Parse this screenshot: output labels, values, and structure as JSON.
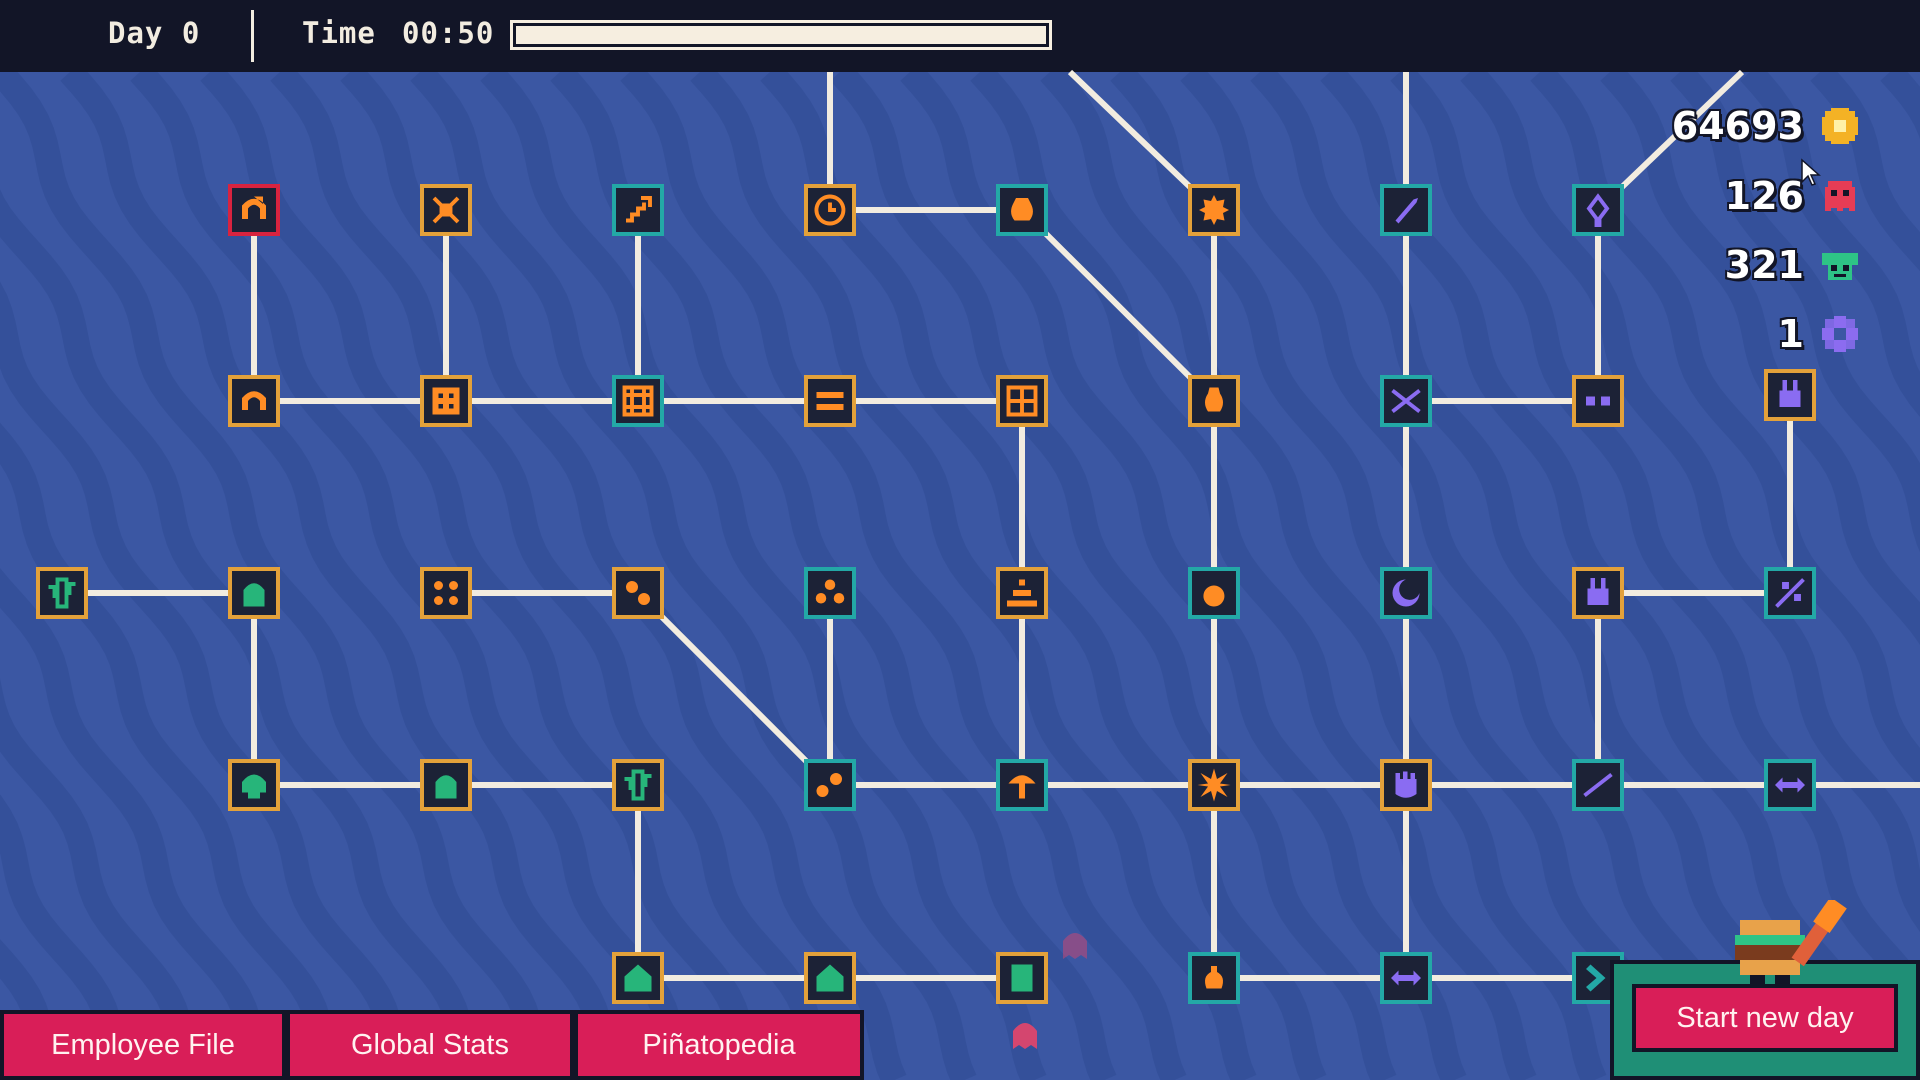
{
  "hud": {
    "day_label": "Day 0",
    "time_label": "Time",
    "time_value": "00:50",
    "time_progress": 1.0
  },
  "resources": [
    {
      "value": "64693",
      "icon": "coin-icon",
      "color": "#f4b225"
    },
    {
      "value": "126",
      "icon": "red-ghost-icon",
      "color": "#e63c55"
    },
    {
      "value": "321",
      "icon": "green-creature-icon",
      "color": "#2ec486"
    },
    {
      "value": "1",
      "icon": "purple-gear-icon",
      "color": "#8c6cf0"
    }
  ],
  "buttons": {
    "employee_file": "Employee File",
    "global_stats": "Global Stats",
    "pinatopedia": "Piñatopedia",
    "start_new_day": "Start new day"
  },
  "colors": {
    "background": "#3b57a3",
    "top_bar": "#121527",
    "button": "#d91e58",
    "node_border_gold": "#e3a13a",
    "node_border_teal": "#23a8a6",
    "node_border_red": "#d8233f",
    "orange_icon": "#ff8c24",
    "green_icon": "#27b57a",
    "purple_icon": "#8a6cf2",
    "link": "#f2ece0"
  },
  "skill_tree": {
    "nodes": [
      {
        "id": "n1",
        "icon": "arch-arrow-icon",
        "color": "orange",
        "border": "red"
      },
      {
        "id": "n2",
        "icon": "crossed-swords-icon",
        "color": "orange",
        "border": "gold"
      },
      {
        "id": "n3",
        "icon": "stairs-arrow-icon",
        "color": "orange",
        "border": "teal"
      },
      {
        "id": "n4",
        "icon": "clock-icon",
        "color": "orange",
        "border": "gold"
      },
      {
        "id": "n5",
        "icon": "pinata-bag-icon",
        "color": "orange",
        "border": "teal"
      },
      {
        "id": "n6",
        "icon": "sun-gear-icon",
        "color": "orange",
        "border": "gold"
      },
      {
        "id": "n7",
        "icon": "blade-icon",
        "color": "purple",
        "border": "teal"
      },
      {
        "id": "n8",
        "icon": "gem-drop-icon",
        "color": "purple",
        "border": "teal"
      },
      {
        "id": "n9",
        "icon": "arch-icon",
        "color": "orange",
        "border": "gold"
      },
      {
        "id": "n10",
        "icon": "dice-frame-icon",
        "color": "orange",
        "border": "gold"
      },
      {
        "id": "n11",
        "icon": "grid-icon",
        "color": "orange",
        "border": "teal"
      },
      {
        "id": "n12",
        "icon": "rows-icon",
        "color": "orange",
        "border": "gold"
      },
      {
        "id": "n13",
        "icon": "window-icon",
        "color": "orange",
        "border": "gold"
      },
      {
        "id": "n14",
        "icon": "bag-icon",
        "color": "orange",
        "border": "gold"
      },
      {
        "id": "n15",
        "icon": "x-mark-icon",
        "color": "purple",
        "border": "teal"
      },
      {
        "id": "n16",
        "icon": "eyes-icon",
        "color": "purple",
        "border": "gold"
      },
      {
        "id": "n17",
        "icon": "bunny-icon",
        "color": "purple",
        "border": "gold"
      },
      {
        "id": "n18",
        "icon": "cactus-icon",
        "color": "green",
        "border": "gold"
      },
      {
        "id": "n19",
        "icon": "tombstone-icon",
        "color": "green",
        "border": "gold"
      },
      {
        "id": "n20",
        "icon": "four-circles-icon",
        "color": "orange",
        "border": "gold"
      },
      {
        "id": "n21",
        "icon": "two-circles-icon",
        "color": "orange",
        "border": "gold"
      },
      {
        "id": "n22",
        "icon": "three-circles-icon",
        "color": "orange",
        "border": "teal"
      },
      {
        "id": "n23",
        "icon": "pyramid-icon",
        "color": "orange",
        "border": "gold"
      },
      {
        "id": "n24",
        "icon": "bomb-icon",
        "color": "orange",
        "border": "teal"
      },
      {
        "id": "n25",
        "icon": "moon-icon",
        "color": "purple",
        "border": "teal"
      },
      {
        "id": "n26",
        "icon": "bunny-icon",
        "color": "purple",
        "border": "gold"
      },
      {
        "id": "n27",
        "icon": "sparkle-line-icon",
        "color": "purple",
        "border": "teal"
      },
      {
        "id": "n28",
        "icon": "skull-icon",
        "color": "green",
        "border": "gold"
      },
      {
        "id": "n29",
        "icon": "tombstone-icon",
        "color": "green",
        "border": "gold"
      },
      {
        "id": "n30",
        "icon": "cactus-icon",
        "color": "green",
        "border": "gold"
      },
      {
        "id": "n31",
        "icon": "chain-circles-icon",
        "color": "orange",
        "border": "teal"
      },
      {
        "id": "n32",
        "icon": "mushroom-icon",
        "color": "orange",
        "border": "teal"
      },
      {
        "id": "n33",
        "icon": "burst-icon",
        "color": "orange",
        "border": "gold"
      },
      {
        "id": "n34",
        "icon": "fist-icon",
        "color": "purple",
        "border": "gold"
      },
      {
        "id": "n35",
        "icon": "dotted-line-icon",
        "color": "purple",
        "border": "teal"
      },
      {
        "id": "n36",
        "icon": "double-arrow-icon",
        "color": "purple",
        "border": "teal"
      },
      {
        "id": "n37",
        "icon": "house-icon",
        "color": "green",
        "border": "gold"
      },
      {
        "id": "n38",
        "icon": "house-gem-icon",
        "color": "green",
        "border": "gold"
      },
      {
        "id": "n39",
        "icon": "scroll-icon",
        "color": "green",
        "border": "gold"
      },
      {
        "id": "n40",
        "icon": "potion-icon",
        "color": "orange",
        "border": "teal"
      },
      {
        "id": "n41",
        "icon": "double-arrow-icon",
        "color": "purple",
        "border": "teal"
      },
      {
        "id": "n42",
        "icon": "chevron-right-icon",
        "color": "teal",
        "border": "teal"
      }
    ]
  }
}
